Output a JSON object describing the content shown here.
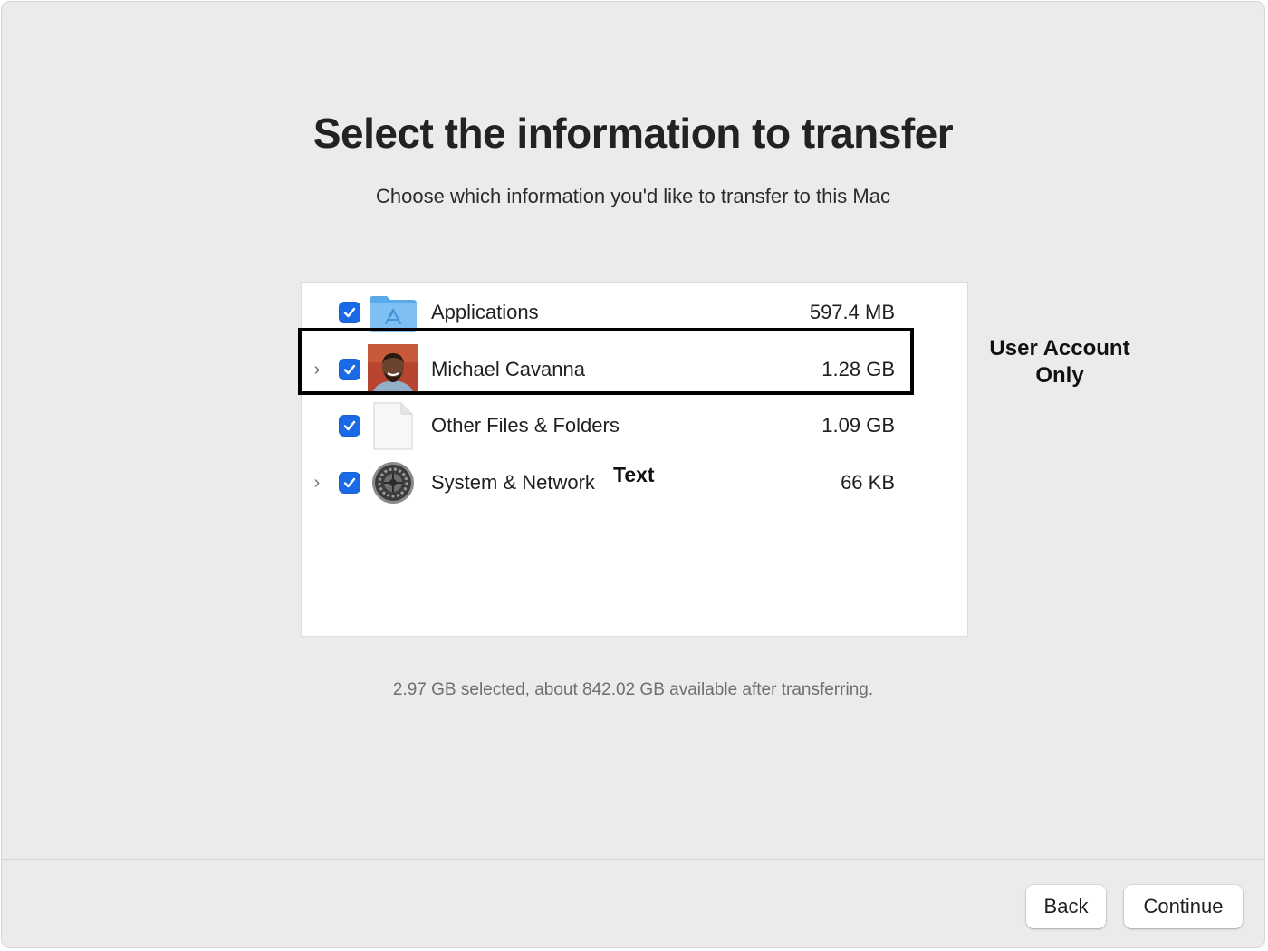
{
  "header": {
    "title": "Select the information to transfer",
    "subtitle": "Choose which information you'd like to transfer to this Mac"
  },
  "items": [
    {
      "label": "Applications",
      "size": "597.4 MB",
      "checked": true,
      "expandable": false,
      "icon": "applications-folder-icon"
    },
    {
      "label": "Michael Cavanna",
      "size": "1.28 GB",
      "checked": true,
      "expandable": true,
      "icon": "user-avatar-icon"
    },
    {
      "label": "Other Files & Folders",
      "size": "1.09 GB",
      "checked": true,
      "expandable": false,
      "icon": "document-icon"
    },
    {
      "label": "System & Network",
      "size": "66 KB",
      "checked": true,
      "expandable": true,
      "icon": "system-preferences-gear-icon"
    }
  ],
  "annotations": {
    "user_account": "User Account Only",
    "text_label": "Text"
  },
  "summary": "2.97 GB selected, about 842.02 GB available after transferring.",
  "buttons": {
    "back": "Back",
    "continue": "Continue"
  },
  "colors": {
    "accent": "#1a6ae8",
    "window_bg": "#ebebeb",
    "panel_bg": "#ffffff",
    "highlight_border": "#000000"
  }
}
